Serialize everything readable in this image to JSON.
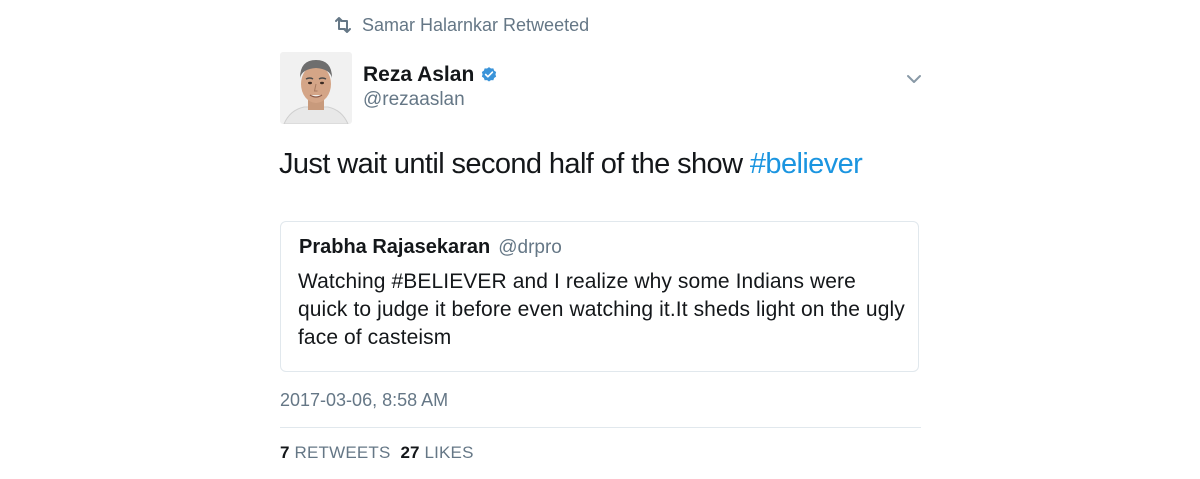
{
  "context": {
    "retweeted_by": "Samar Halarnkar Retweeted",
    "icon": "retweet-icon"
  },
  "author": {
    "name": "Reza Aslan",
    "handle": "@rezaaslan",
    "verified_icon": "verified-badge-icon",
    "verified_color": "#3b94d9"
  },
  "tweet": {
    "text": "Just wait until second half of the show ",
    "hashtag": "#believer",
    "hashtag_color": "#1b95e0"
  },
  "quoted": {
    "name": "Prabha Rajasekaran",
    "handle": "@drpro",
    "text": "Watching #BELIEVER and I realize why some Indians were quick to judge it before even watching it.It sheds light on the ugly face of casteism"
  },
  "timestamp": "2017-03-06, 8:58 AM",
  "stats": {
    "retweets_count": "7",
    "retweets_label": "RETWEETS",
    "likes_count": "27",
    "likes_label": "LIKES"
  },
  "colors": {
    "text": "#14171a",
    "secondary": "#657786",
    "border": "#e1e8ed"
  }
}
